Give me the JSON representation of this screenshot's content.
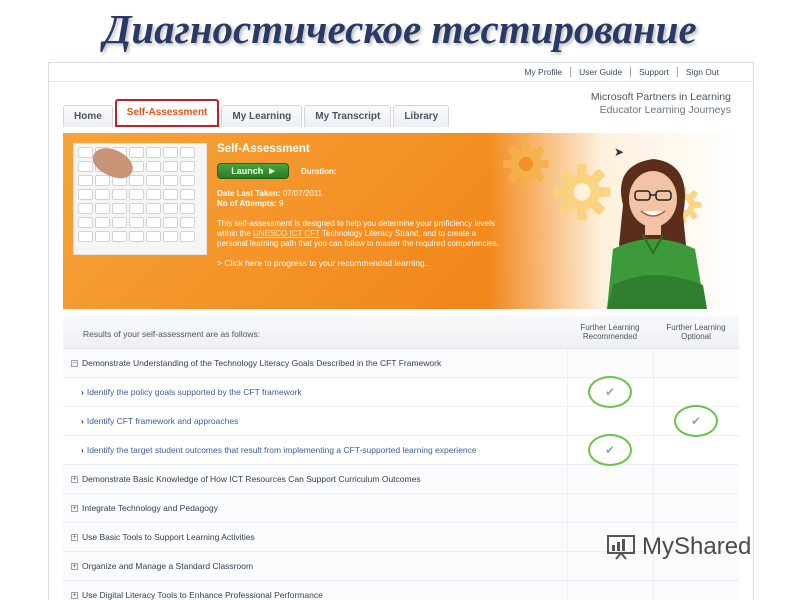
{
  "slide": {
    "title": "Диагностическое тестирование"
  },
  "top_links": [
    "My Profile",
    "User Guide",
    "Support",
    "Sign Out"
  ],
  "brand": {
    "line1": "Microsoft Partners in Learning",
    "line2": "Educator Learning Journeys"
  },
  "tabs": [
    {
      "label": "Home",
      "active": false
    },
    {
      "label": "Self-Assessment",
      "active": true
    },
    {
      "label": "My Learning",
      "active": false
    },
    {
      "label": "My Transcript",
      "active": false
    },
    {
      "label": "Library",
      "active": false
    }
  ],
  "banner": {
    "title": "Self-Assessment",
    "launch_label": "Launch",
    "duration_label": "Duration:",
    "date_label": "Date Last Taken:",
    "date_value": "07/07/2011",
    "attempts_label": "No of Attempts:",
    "attempts_value": "9",
    "desc_pre": "This self-assessment is designed to help you determine your proficiency levels within the",
    "desc_hl": "UNESCO ICT CFT",
    "desc_post": "Technology Literacy Strand, and to create a personal learning path that you can follow to master the required competencies.",
    "progress_link": "> Click here to progress to your recommended learning."
  },
  "results": {
    "header": "Results of your self-assessment are as follows:",
    "col_recommended": [
      "Further Learning",
      "Recommended"
    ],
    "col_optional": [
      "Further Learning",
      "Optional"
    ],
    "rows": [
      {
        "type": "group",
        "expanded": true,
        "text": "Demonstrate Understanding of the Technology Literacy Goals Described in the CFT Framework",
        "recommended": false,
        "optional": false
      },
      {
        "type": "sub",
        "text": "Identify the policy goals supported by the CFT framework",
        "recommended": true,
        "optional": false
      },
      {
        "type": "sub",
        "text": "Identify CFT framework and approaches",
        "recommended": false,
        "optional": true
      },
      {
        "type": "sub",
        "text": "Identify the target student outcomes that result from implementing a CFT-supported learning experience",
        "recommended": true,
        "optional": false
      },
      {
        "type": "group",
        "expanded": false,
        "text": "Demonstrate Basic Knowledge of How ICT Resources Can Support Curriculum Outcomes",
        "recommended": false,
        "optional": false
      },
      {
        "type": "group",
        "expanded": false,
        "text": "Integrate Technology and Pedagogy",
        "recommended": false,
        "optional": false
      },
      {
        "type": "group",
        "expanded": false,
        "text": "Use Basic Tools to Support Learning Activities",
        "recommended": false,
        "optional": false
      },
      {
        "type": "group",
        "expanded": false,
        "text": "Organize and Manage a Standard Classroom",
        "recommended": false,
        "optional": false
      },
      {
        "type": "group",
        "expanded": false,
        "text": "Use Digital Literacy Tools to Enhance Professional Performance",
        "recommended": false,
        "optional": false
      }
    ]
  },
  "watermark": {
    "text": "MyShared"
  },
  "colors": {
    "accent": "#e0541c",
    "banner": "#f28a1e",
    "check": "#6cc24a",
    "tab_outline": "#c0202a"
  },
  "icons": {
    "check": "✔",
    "expand": "+",
    "collapse": "−",
    "chevron": "›"
  }
}
